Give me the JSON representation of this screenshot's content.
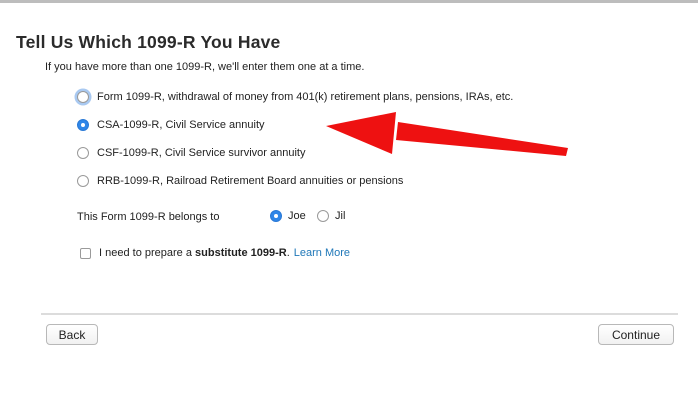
{
  "page": {
    "title": "Tell Us Which 1099-R You Have",
    "subtitle": "If you have more than one 1099-R, we'll enter them one at a time."
  },
  "form_options": [
    {
      "label": "Form 1099-R, withdrawal of money from 401(k) retirement plans, pensions, IRAs, etc.",
      "selected": false
    },
    {
      "label": "CSA-1099-R, Civil Service annuity",
      "selected": true
    },
    {
      "label": "CSF-1099-R, Civil Service survivor annuity",
      "selected": false
    },
    {
      "label": "RRB-1099-R, Railroad Retirement Board annuities or pensions",
      "selected": false
    }
  ],
  "owner": {
    "label": "This Form 1099-R belongs to",
    "options": [
      {
        "label": "Joe",
        "selected": true
      },
      {
        "label": "Jil",
        "selected": false
      }
    ]
  },
  "substitute": {
    "prefix": "I need to prepare a ",
    "bold": "substitute 1099-R",
    "suffix": ".",
    "link": "Learn More",
    "checked": false
  },
  "buttons": {
    "back": "Back",
    "continue": "Continue"
  },
  "colors": {
    "accent": "#2f86e8",
    "link": "#1f77b8",
    "annotation_arrow": "#ee1111"
  }
}
